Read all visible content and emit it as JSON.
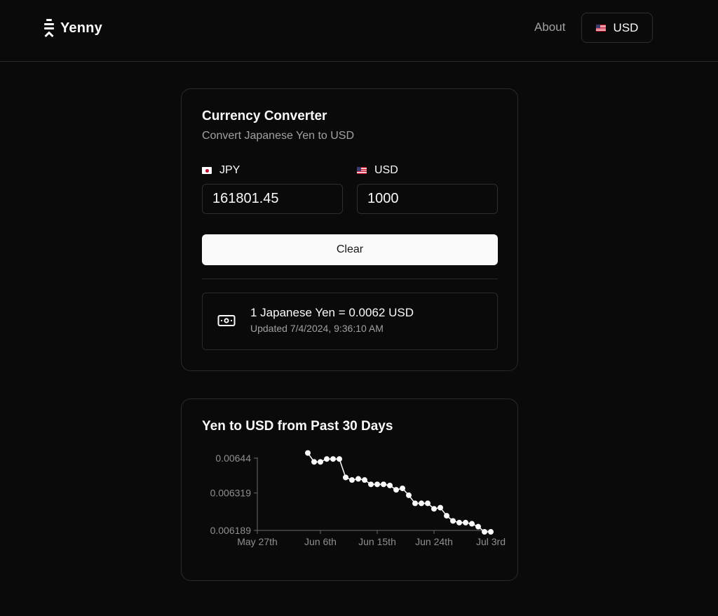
{
  "header": {
    "logo_text": "Yenny",
    "about_label": "About",
    "currency_button": {
      "code": "USD",
      "flag_icon": "us-flag-icon"
    }
  },
  "converter": {
    "title": "Currency Converter",
    "subtitle": "Convert Japanese Yen to USD",
    "from": {
      "code": "JPY",
      "flag_icon": "jp-flag-icon",
      "value": "161801.45"
    },
    "to": {
      "code": "USD",
      "flag_icon": "us-flag-icon",
      "value": "1000"
    },
    "clear_label": "Clear",
    "rate": {
      "icon": "banknote-icon",
      "text": "1 Japanese Yen = 0.0062 USD",
      "updated": "Updated 7/4/2024, 9:36:10 AM"
    }
  },
  "chart_data": {
    "type": "line",
    "title": "Yen to USD from Past 30 Days",
    "xlabel": "",
    "ylabel": "",
    "x_ticks": [
      "May 27th",
      "Jun 6th",
      "Jun 15th",
      "Jun 24th",
      "Jul 3rd"
    ],
    "y_ticks": [
      "0.00644",
      "0.006319",
      "0.006189"
    ],
    "ylim": [
      0.006189,
      0.00644
    ],
    "xlim": [
      "2024-05-27",
      "2024-07-03"
    ],
    "grid": false,
    "colors": {
      "line": "#fafafa",
      "point": "#fafafa",
      "axis": "#6b6b6b"
    },
    "series": [
      {
        "x": [
          "2024-06-04",
          "2024-06-05",
          "2024-06-06",
          "2024-06-07",
          "2024-06-08",
          "2024-06-09",
          "2024-06-10",
          "2024-06-11",
          "2024-06-12",
          "2024-06-13",
          "2024-06-14",
          "2024-06-15",
          "2024-06-16",
          "2024-06-17",
          "2024-06-18",
          "2024-06-19",
          "2024-06-20",
          "2024-06-21",
          "2024-06-22",
          "2024-06-23",
          "2024-06-24",
          "2024-06-25",
          "2024-06-26",
          "2024-06-27",
          "2024-06-28",
          "2024-06-29",
          "2024-06-30",
          "2024-07-01",
          "2024-07-02",
          "2024-07-03"
        ],
        "values": [
          0.006458,
          0.006427,
          0.006427,
          0.006437,
          0.006437,
          0.006437,
          0.006373,
          0.006364,
          0.006368,
          0.006364,
          0.006349,
          0.006349,
          0.006349,
          0.006345,
          0.00633,
          0.006335,
          0.006311,
          0.006283,
          0.006283,
          0.006283,
          0.006264,
          0.006268,
          0.00624,
          0.006222,
          0.006216,
          0.006216,
          0.006212,
          0.006202,
          0.006184,
          0.006184
        ]
      }
    ]
  }
}
